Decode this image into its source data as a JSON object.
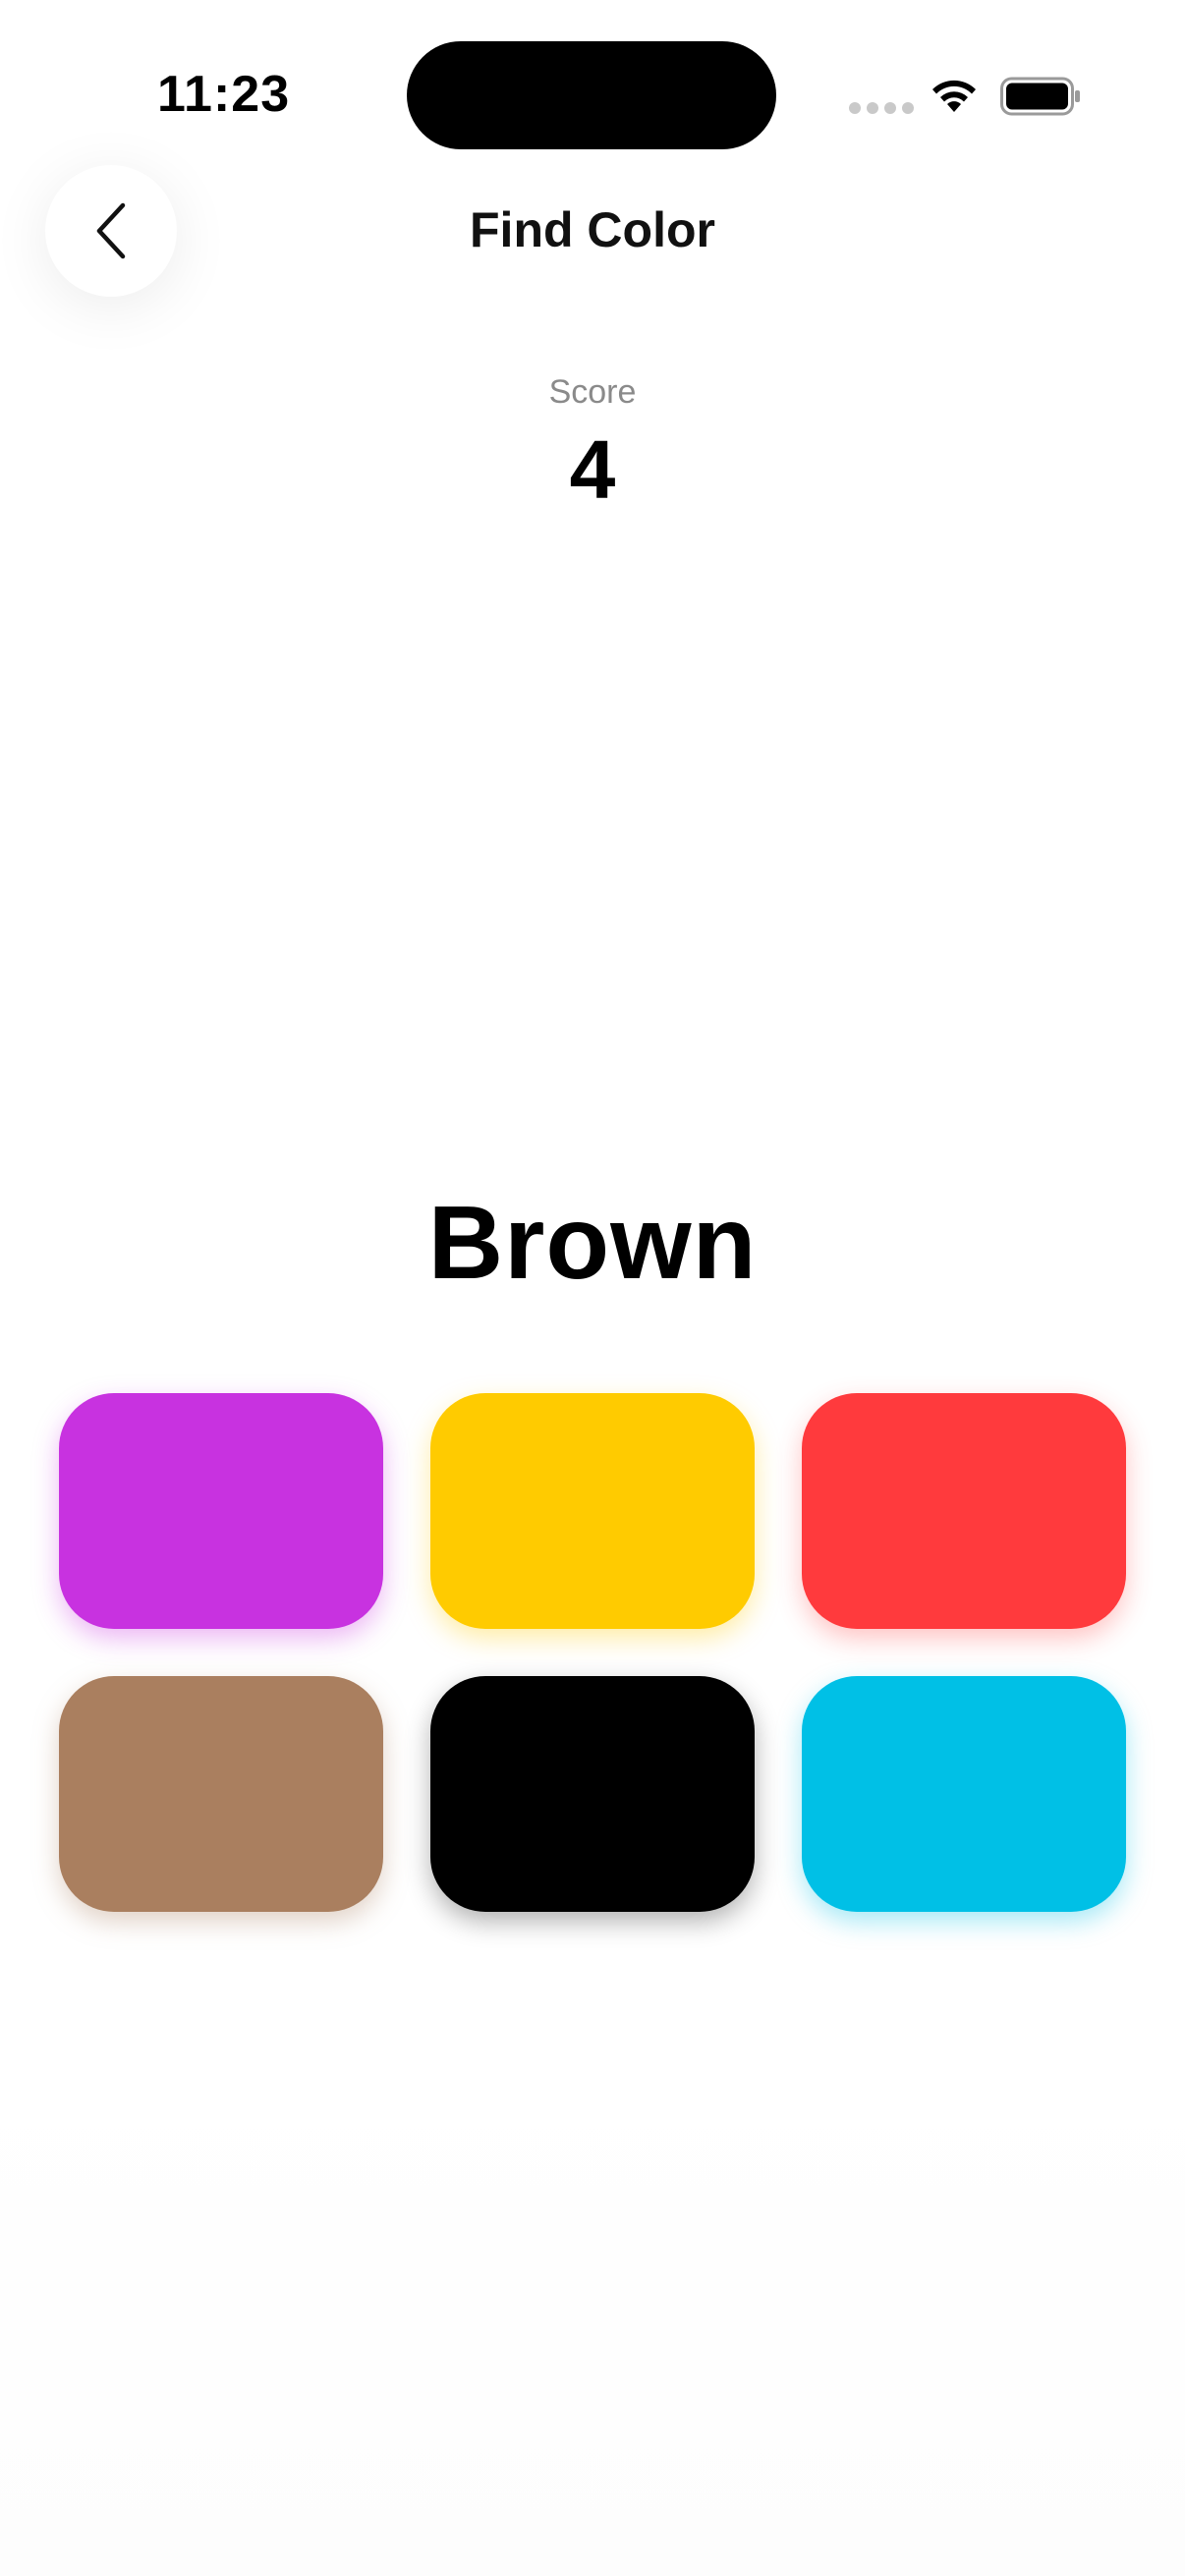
{
  "status_bar": {
    "time": "11:23"
  },
  "nav": {
    "back_icon": "chevron-left-icon",
    "title": "Find Color"
  },
  "score": {
    "label": "Score",
    "value": "4"
  },
  "target_color": "Brown",
  "tiles": [
    {
      "name": "purple",
      "color": "#c832e0",
      "shadow": "rgba(200,50,224,0.35)"
    },
    {
      "name": "yellow",
      "color": "#ffcb00",
      "shadow": "rgba(255,203,0,0.35)"
    },
    {
      "name": "red",
      "color": "#ff3a3d",
      "shadow": "rgba(255,58,61,0.30)"
    },
    {
      "name": "brown",
      "color": "#aa7f5f",
      "shadow": "rgba(170,127,95,0.35)"
    },
    {
      "name": "black",
      "color": "#000000",
      "shadow": "rgba(0,0,0,0.30)"
    },
    {
      "name": "cyan",
      "color": "#00c0e6",
      "shadow": "rgba(0,192,230,0.35)"
    }
  ]
}
